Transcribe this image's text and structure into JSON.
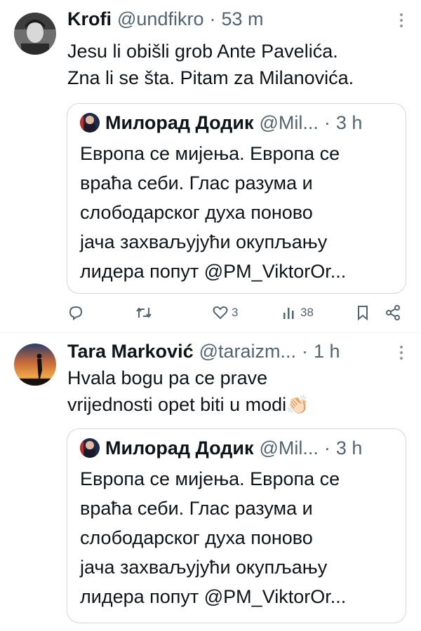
{
  "tweets": [
    {
      "name": "Krofi",
      "handle": "@undfikro",
      "sep": "·",
      "time": "53 m",
      "text_line1": "Jesu li obišli grob Ante Pavelića.",
      "text_line2": "Zna li se šta. Pitam za Milanovića.",
      "quote": {
        "name": "Милорад Додик",
        "handle": "@Mil...",
        "sep": "·",
        "time": "3 h",
        "lines": [
          "Европа се мијења. Европа се",
          "враћа себи. Глас разума и",
          "слободарског духа поново",
          "јача захваљујући окупљању",
          "лидера попут @PM_ViktorOr..."
        ]
      },
      "actions": {
        "likes": "3",
        "views": "38"
      }
    },
    {
      "name": "Tara Marković",
      "handle": "@taraizm...",
      "sep": "·",
      "time": "1 h",
      "text_line1": "Hvala bogu pa ce prave",
      "text_line2": "vrijednosti opet biti u modi",
      "emoji": "👏🏻",
      "quote": {
        "name": "Милорад Додик",
        "handle": "@Mil...",
        "sep": "·",
        "time": "3 h",
        "lines": [
          "Европа се мијења. Европа се",
          "враћа себи. Глас разума и",
          "слободарског духа поново",
          "јача захваљујући окупљању",
          "лидера попут @PM_ViktorOr..."
        ]
      }
    }
  ],
  "icons": {
    "reply": "reply-icon",
    "retweet": "retweet-icon",
    "like": "heart-icon",
    "views": "views-icon",
    "bookmark": "bookmark-icon",
    "share": "share-icon",
    "more": "more-icon"
  },
  "colors": {
    "text": "#0f1419",
    "muted": "#536471",
    "border": "#cfd9de"
  }
}
